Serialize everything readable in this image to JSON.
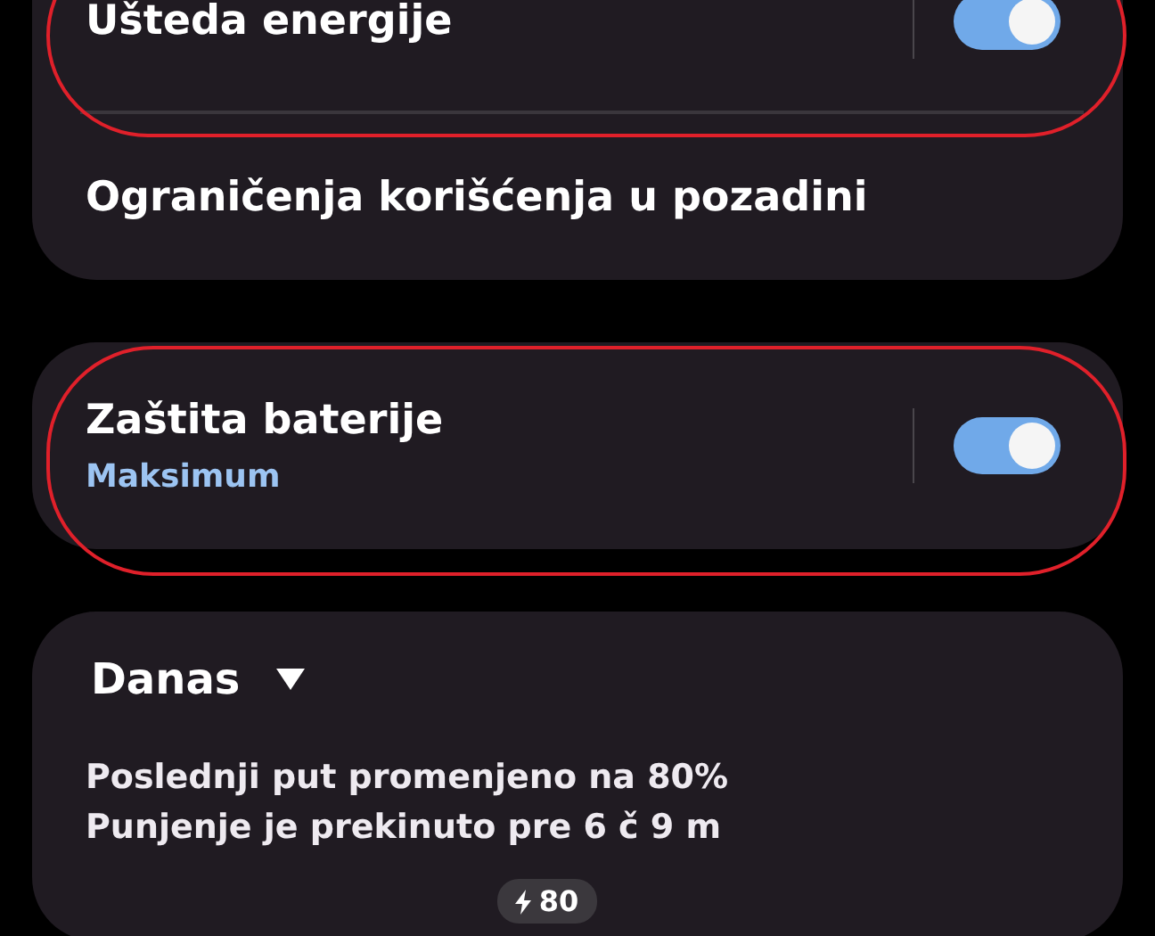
{
  "cards": [
    {
      "items": [
        {
          "kind": "switch",
          "title": "Ušteda energije",
          "on": true,
          "highlighted": true
        },
        {
          "kind": "link",
          "title": "Ograničenja korišćenja u pozadini",
          "highlighted": false
        }
      ]
    },
    {
      "items": [
        {
          "kind": "switch",
          "title": "Zaštita baterije",
          "subtitle": "Maksimum",
          "on": true,
          "highlighted": true
        }
      ]
    }
  ],
  "history": {
    "period": "Danas",
    "lines": [
      "Poslednji put promenjeno na 80%",
      "Punjenje je prekinuto pre 6 č 9 m"
    ],
    "chart_badge": "80"
  }
}
